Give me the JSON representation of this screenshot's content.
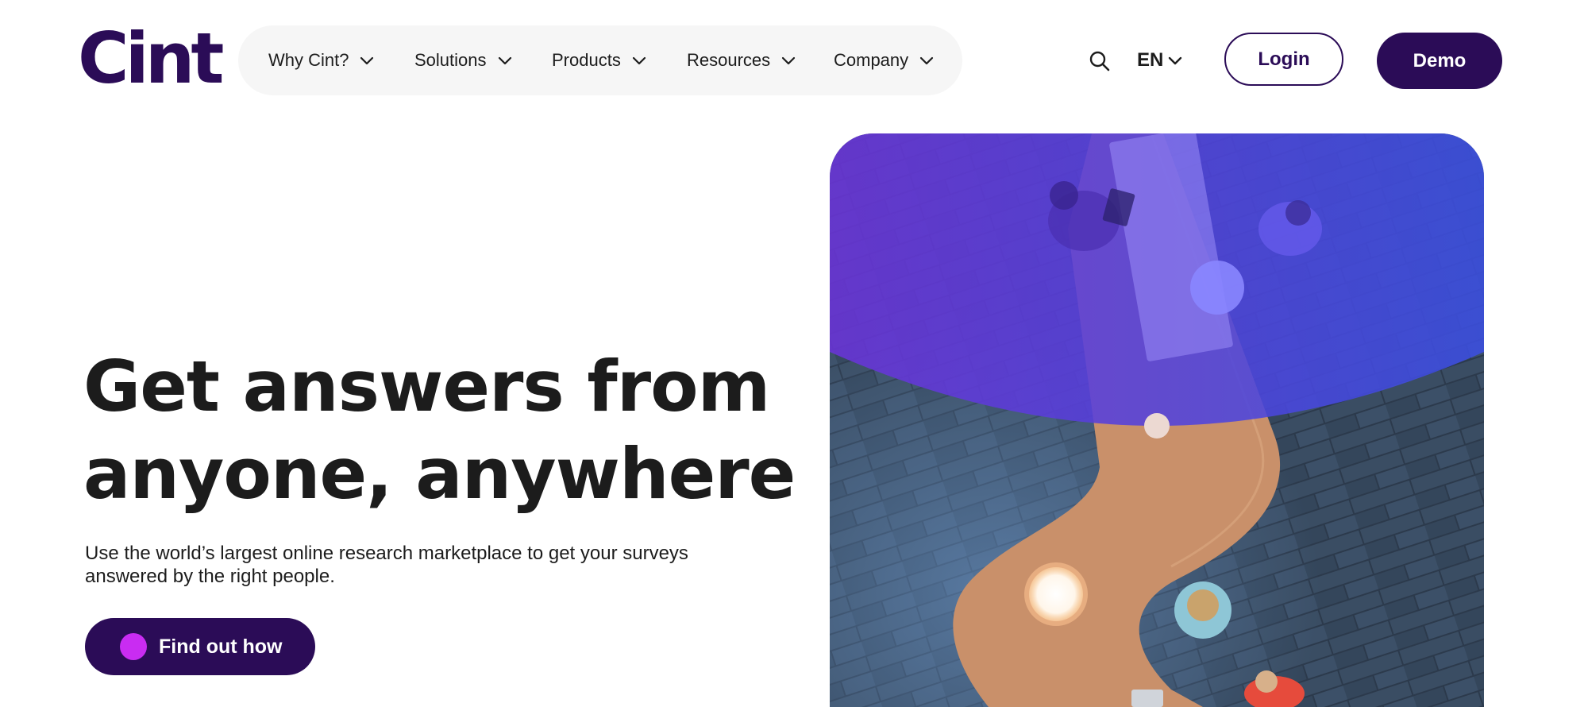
{
  "header": {
    "logo_text": "Cint",
    "nav": [
      {
        "label": "Why Cint?"
      },
      {
        "label": "Solutions"
      },
      {
        "label": "Products"
      },
      {
        "label": "Resources"
      },
      {
        "label": "Company"
      }
    ],
    "search_icon": "search-icon",
    "language": "EN",
    "login_label": "Login",
    "demo_label": "Demo"
  },
  "hero": {
    "headline_line1": "Get answers from",
    "headline_line2": "anyone, anywhere",
    "subtext": "Use the world’s largest online research marketplace to get your surveys answered by the right people.",
    "cta_label": "Find out how",
    "image_alt": "Overhead view of people working at a curved wooden table with a purple overlay"
  },
  "colors": {
    "brand_purple": "#2b0c57",
    "accent_magenta": "#c92cf2",
    "overlay_purple": "#5a3ef0",
    "text": "#1c1c1c",
    "nav_bg": "#f6f6f6"
  }
}
